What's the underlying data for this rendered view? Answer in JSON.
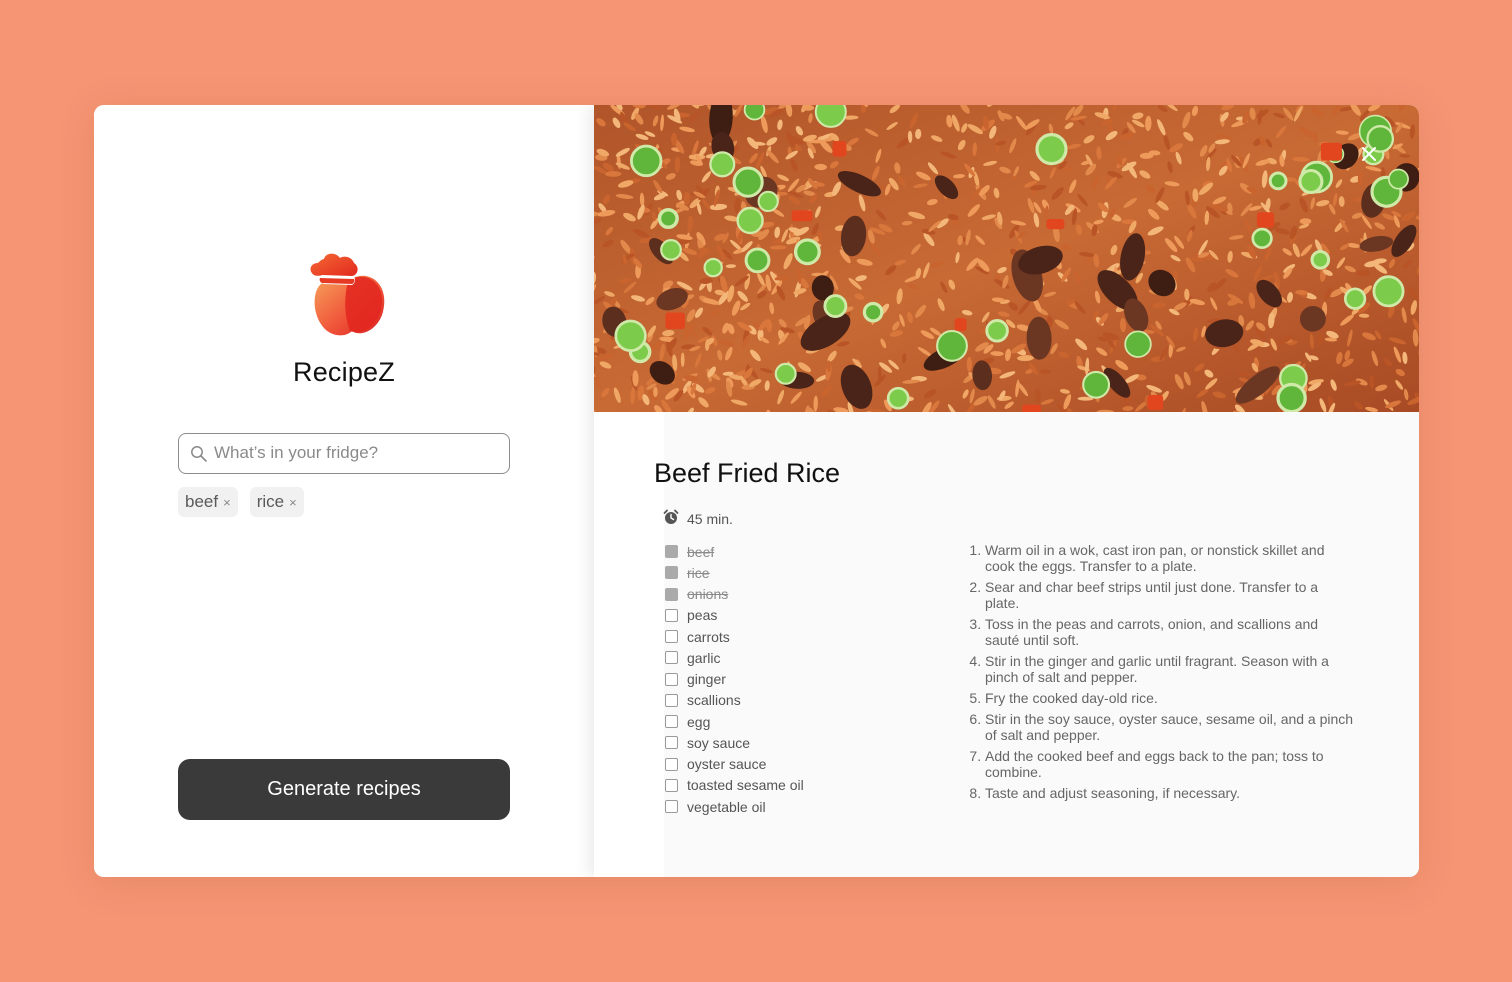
{
  "app": {
    "name": "RecipeZ"
  },
  "search": {
    "placeholder": "What’s in your fridge?",
    "value": ""
  },
  "tags": [
    {
      "label": "beef",
      "remove": "×"
    },
    {
      "label": "rice",
      "remove": "×"
    }
  ],
  "generate_button": "Generate recipes",
  "recipe": {
    "title": "Beef Fried Rice",
    "time": "45 min.",
    "ingredients": [
      {
        "name": "beef",
        "checked": true
      },
      {
        "name": "rice",
        "checked": true
      },
      {
        "name": "onions",
        "checked": true
      },
      {
        "name": "peas",
        "checked": false
      },
      {
        "name": "carrots",
        "checked": false
      },
      {
        "name": "garlic",
        "checked": false
      },
      {
        "name": "ginger",
        "checked": false
      },
      {
        "name": "scallions",
        "checked": false
      },
      {
        "name": "egg",
        "checked": false
      },
      {
        "name": "soy sauce",
        "checked": false
      },
      {
        "name": "oyster sauce",
        "checked": false
      },
      {
        "name": "toasted sesame oil",
        "checked": false
      },
      {
        "name": "vegetable oil",
        "checked": false
      }
    ],
    "steps": [
      "Warm oil in a wok, cast iron pan, or nonstick skillet and cook the eggs. Transfer to a plate.",
      "Sear and char beef strips until just done. Transfer to a plate.",
      "Toss in the peas and carrots, onion, and scallions and sauté until soft.",
      "Stir in the ginger and garlic until fragrant. Season with a pinch of salt and pepper.",
      "Fry the cooked day-old rice.",
      "Stir in the soy sauce, oyster sauce, sesame oil, and a pinch of salt and pepper.",
      "Add the cooked beef and eggs back to the pan; toss to combine.",
      "Taste and adjust seasoning, if necessary."
    ]
  },
  "icons": {
    "logo": "chef-apple-icon",
    "search": "search-icon",
    "close": "close-icon",
    "time": "alarm-clock-icon"
  },
  "colors": {
    "background": "#f59574",
    "button": "#3a3a3a",
    "logo_red": "#e8322a",
    "logo_orange": "#f47b3a"
  }
}
